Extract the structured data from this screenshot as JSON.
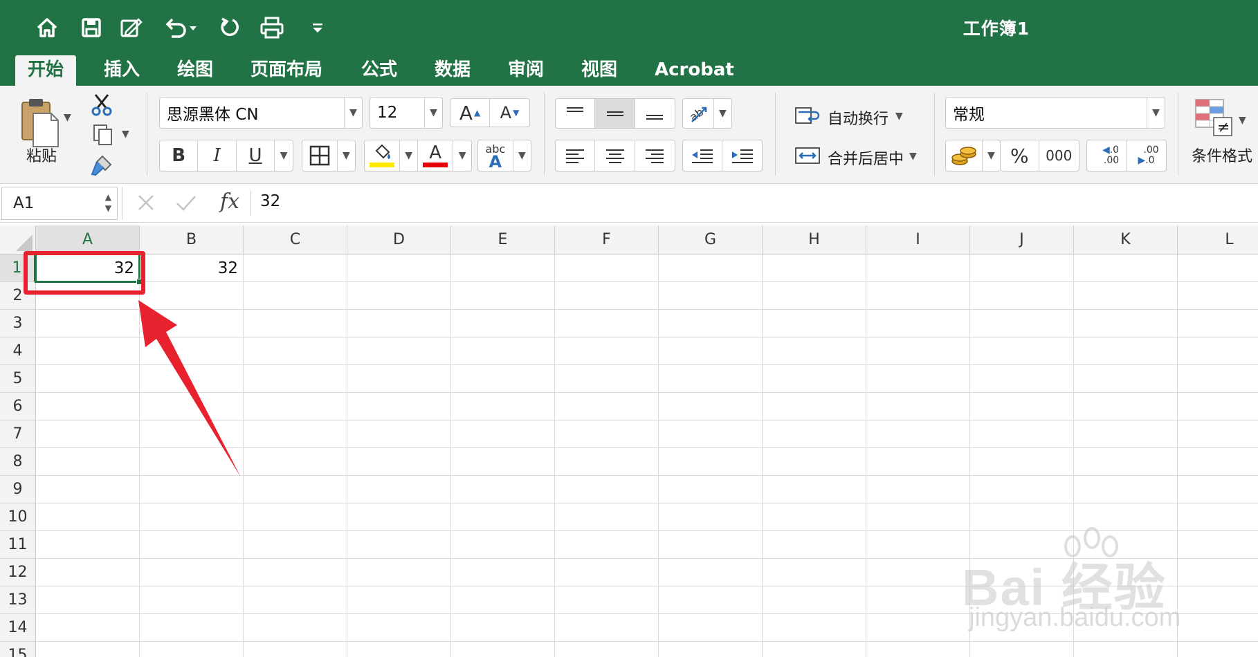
{
  "app": {
    "doc_title": "工作簿1",
    "accent_color": "#217346",
    "annotation_color": "#e8212e"
  },
  "quick_access": [
    {
      "name": "home-icon"
    },
    {
      "name": "save-icon"
    },
    {
      "name": "edit-icon"
    },
    {
      "name": "undo-icon"
    },
    {
      "name": "redo-icon"
    },
    {
      "name": "print-icon"
    },
    {
      "name": "customize-icon"
    }
  ],
  "tabs": [
    {
      "label": "开始",
      "active": true
    },
    {
      "label": "插入"
    },
    {
      "label": "绘图"
    },
    {
      "label": "页面布局"
    },
    {
      "label": "公式"
    },
    {
      "label": "数据"
    },
    {
      "label": "审阅"
    },
    {
      "label": "视图"
    },
    {
      "label": "Acrobat"
    }
  ],
  "ribbon": {
    "paste_label": "粘贴",
    "font_name": "思源黑体 CN",
    "font_size": "12",
    "bold": "B",
    "italic": "I",
    "underline": "U",
    "grow_font": "A",
    "shrink_font": "A",
    "font_color_glyph": "A",
    "abc_glyph": "abc",
    "wrap_text": "自动换行",
    "merge_center": "合并后居中",
    "number_format": "常规",
    "percent": "%",
    "thousands": "000",
    "conditional_format": "条件格式",
    "inc_decimal_top": ".0",
    "inc_decimal_bottom": ".00",
    "dec_decimal_top": ".00",
    "dec_decimal_bottom": ".0"
  },
  "formula_bar": {
    "name_box": "A1",
    "fx": "fx",
    "value": "32"
  },
  "sheet": {
    "columns": [
      "A",
      "B",
      "C",
      "D",
      "E",
      "F",
      "G",
      "H",
      "I",
      "J",
      "K",
      "L"
    ],
    "rows": [
      "1",
      "2",
      "3",
      "4",
      "5",
      "6",
      "7",
      "8",
      "9",
      "10",
      "11",
      "12",
      "13",
      "14",
      "15"
    ],
    "selected_col": "A",
    "selected_row": "1",
    "cells": [
      {
        "ref": "A1",
        "col": 0,
        "row": 0,
        "value": "32"
      },
      {
        "ref": "B1",
        "col": 1,
        "row": 0,
        "value": "32"
      }
    ]
  },
  "watermark": {
    "text": "Bai 经验",
    "url": "jingyan.baidu.com"
  }
}
